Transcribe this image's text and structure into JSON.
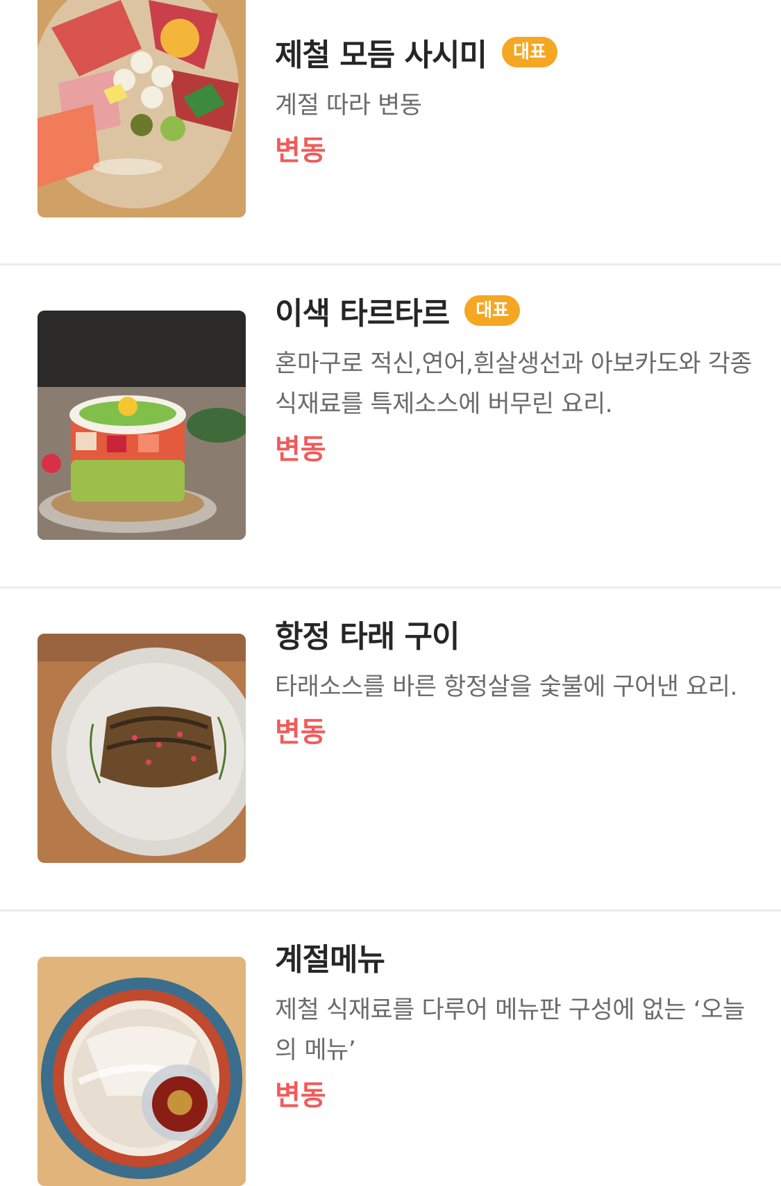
{
  "menu": {
    "items": [
      {
        "name": "제철 모듬 사시미",
        "badge": "대표",
        "description": "계절 따라 변동",
        "price": "변동",
        "photo": "sashimi-platter-photo"
      },
      {
        "name": "이색 타르타르",
        "badge": "대표",
        "description": "혼마구로 적신,연어,흰살생선과 아보카도와 각종 식재료를 특제소스에 버무린 요리.",
        "price": "변동",
        "photo": "tartare-photo"
      },
      {
        "name": "항정 타래 구이",
        "badge": "",
        "description": "타래소스를 바른 항정살을 숯불에 구어낸 요리.",
        "price": "변동",
        "photo": "grilled-pork-jowl-photo"
      },
      {
        "name": "계절메뉴",
        "badge": "",
        "description": "제철 식재료를 다루어 메뉴판 구성에 없는 ‘오늘의 메뉴’",
        "price": "변동",
        "photo": "seasonal-dish-photo"
      }
    ]
  },
  "colors": {
    "badge": "#f5a623",
    "price": "#f25a5a",
    "title": "#262626",
    "description": "#6b6b6b",
    "divider": "#ececec"
  }
}
